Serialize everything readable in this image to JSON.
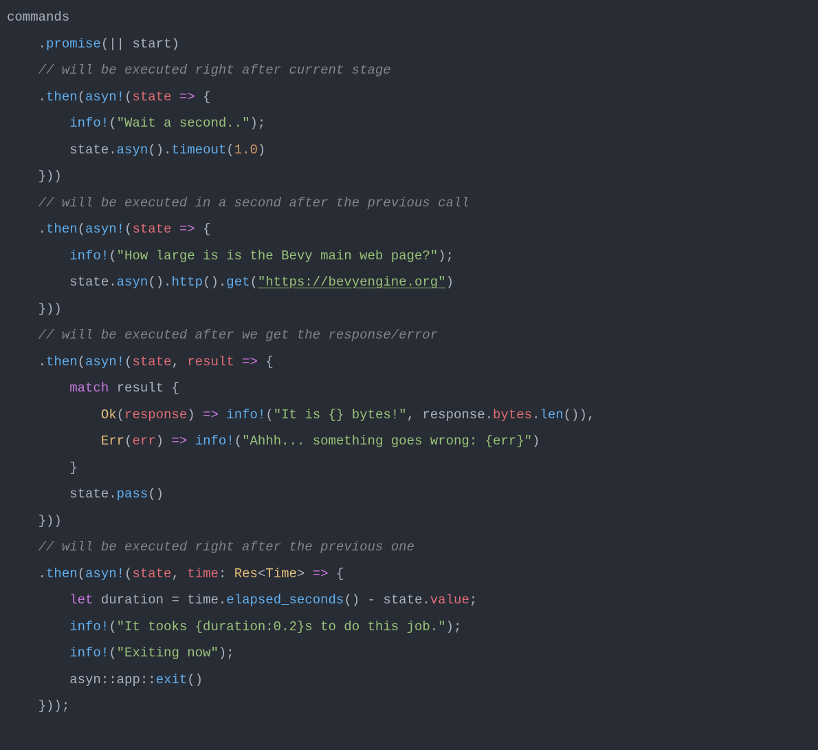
{
  "code": {
    "ident_commands": "commands",
    "method_promise": "promise",
    "closure_bar": "||",
    "ident_start": "start",
    "comment_after_stage": "// will be executed right after current stage",
    "method_then": "then",
    "macro_asyn": "asyn",
    "bang": "!",
    "ident_state": "state",
    "arrow": "=>",
    "lbrace": "{",
    "macro_info": "info",
    "str_wait": "\"Wait a second..\"",
    "method_asyn": "asyn",
    "method_timeout": "timeout",
    "num_1_0": "1.0",
    "rbrace_pp": "}))",
    "comment_in_second": "// will be executed in a second after the previous call",
    "str_how_large": "\"How large is is the Bevy main web page?\"",
    "method_http": "http",
    "method_get": "get",
    "str_url": "\"https://bevyengine.org\"",
    "comment_after_resp": "// will be executed after we get the response/error",
    "ident_result": "result",
    "kw_match": "match",
    "type_ok": "Ok",
    "ident_response": "response",
    "str_it_is_bytes": "\"It is {} bytes!\"",
    "comma_sp": ", ",
    "ident_bytes": "bytes",
    "method_len": "len",
    "type_err": "Err",
    "ident_err": "err",
    "str_ahhh": "\"Ahhh... something goes wrong: {err}\"",
    "rbrace": "}",
    "method_pass": "pass",
    "comment_after_prev": "// will be executed right after the previous one",
    "ident_time": "time",
    "colon": ":",
    "type_res": "Res",
    "lt": "<",
    "type_time": "Time",
    "gt": ">",
    "kw_let": "let",
    "ident_duration": "duration",
    "eq": "=",
    "method_elapsed": "elapsed_seconds",
    "minus": "-",
    "ident_value": "value",
    "semicolon": ";",
    "str_tooks": "\"It tooks {duration:0.2}s to do this job.\"",
    "str_exiting": "\"Exiting now\"",
    "path_asyn_app_exit": "asyn::app::exit",
    "path_asyn": "asyn",
    "path_cc": "::",
    "path_app": "app",
    "method_exit": "exit",
    "rbrace_pp_semi": "}));"
  }
}
